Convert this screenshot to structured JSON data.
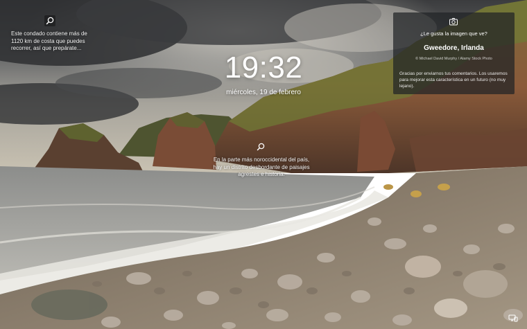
{
  "lockscreen": {
    "time": "19:32",
    "date": "miércoles, 19 de febrero"
  },
  "hotspots": [
    {
      "icon": "search-icon",
      "text": "Este condado contiene más de 1120 km de costa que puedes recorrer, así que prepárate..."
    },
    {
      "icon": "search-icon",
      "text": "En la parte más noroccidental del país, hay un distrito desbordante de paisajes agrestes e historia."
    }
  ],
  "info_card": {
    "icon": "camera-icon",
    "question": "¿Le gusta la imagen que ve?",
    "location": "Gweedore, Irlanda",
    "credit": "© Michael David Murphy / Alamy Stock Photo",
    "feedback": "Gracias por enviarnos tus comentarios. Los usaremos para mejorar esta característica en un futuro (no muy lejano)."
  },
  "status": {
    "icon": "network-icon"
  }
}
